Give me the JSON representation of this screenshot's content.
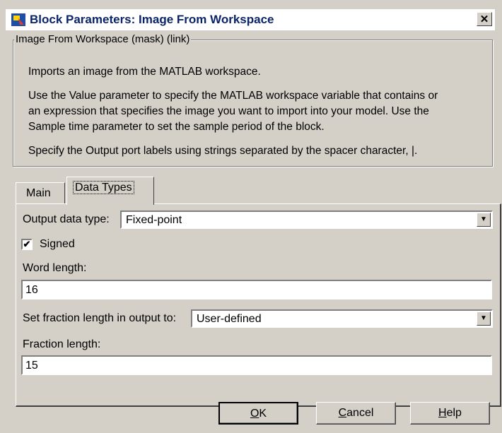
{
  "window": {
    "title": "Block Parameters: Image From Workspace",
    "close_glyph": "✕"
  },
  "group": {
    "legend": "Image From Workspace (mask) (link)",
    "desc1": "Imports an image from the MATLAB workspace.",
    "desc2a": "Use the Value parameter to specify the MATLAB workspace variable that contains or",
    "desc2b": "an expression that specifies the image you want to import into your model. Use the",
    "desc2c": "Sample time parameter to set the sample period of the block.",
    "desc3": "Specify the Output port labels using strings separated by the spacer character, |."
  },
  "tabs": {
    "main": "Main",
    "data_types": "Data Types"
  },
  "form": {
    "output_data_type_label": "Output data type:",
    "output_data_type_value": "Fixed-point",
    "signed_label": "Signed",
    "signed_checked": "✔",
    "word_length_label": "Word length:",
    "word_length_value": "16",
    "fraction_mode_label": "Set fraction length in output to:",
    "fraction_mode_value": "User-defined",
    "fraction_length_label": "Fraction length:",
    "fraction_length_value": "15",
    "dropdown_arrow": "▼"
  },
  "buttons": {
    "ok_u": "O",
    "ok_rest": "K",
    "cancel_u": "C",
    "cancel_rest": "ancel",
    "help_u": "H",
    "help_rest": "elp"
  }
}
